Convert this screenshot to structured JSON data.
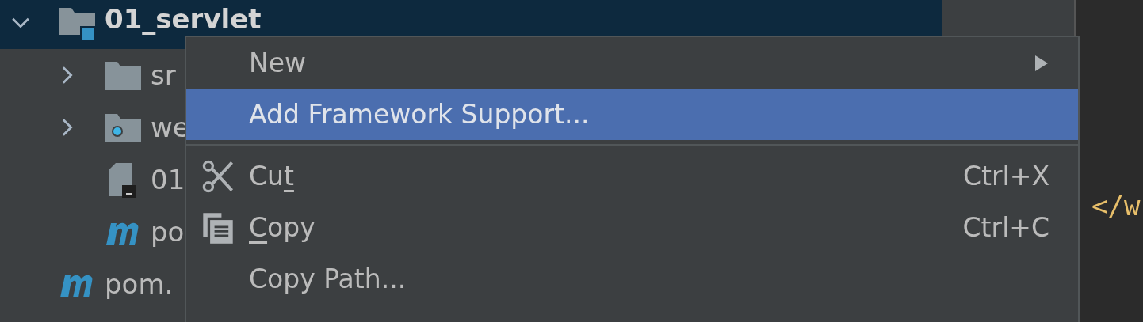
{
  "project_tree": [
    {
      "label": "01_servlet",
      "kind": "module-folder",
      "expanded": true,
      "selected": true,
      "children": [
        {
          "label": "sr",
          "kind": "folder",
          "expanded": false,
          "selected": false
        },
        {
          "label": "we",
          "kind": "web-folder",
          "expanded": false,
          "selected": false
        },
        {
          "label": "01",
          "kind": "iml-file",
          "selected": false
        },
        {
          "label": "po",
          "kind": "maven",
          "selected": false
        }
      ]
    },
    {
      "label": "pom.",
      "kind": "maven",
      "selected": false
    }
  ],
  "context_menu": {
    "items": [
      {
        "kind": "submenu",
        "label": "New",
        "highlighted": false
      },
      {
        "kind": "action",
        "label": "Add Framework Support...",
        "highlighted": true
      },
      {
        "kind": "separator"
      },
      {
        "kind": "cut",
        "label_before": "Cu",
        "mnemonic": "t",
        "shortcut": "Ctrl+X",
        "highlighted": false
      },
      {
        "kind": "copy",
        "mnemonic": "C",
        "label_after": "opy",
        "shortcut": "Ctrl+C",
        "highlighted": false
      },
      {
        "kind": "action",
        "label": "Copy Path...",
        "highlighted": false
      }
    ]
  },
  "editor": {
    "code_fragment": "</w"
  }
}
